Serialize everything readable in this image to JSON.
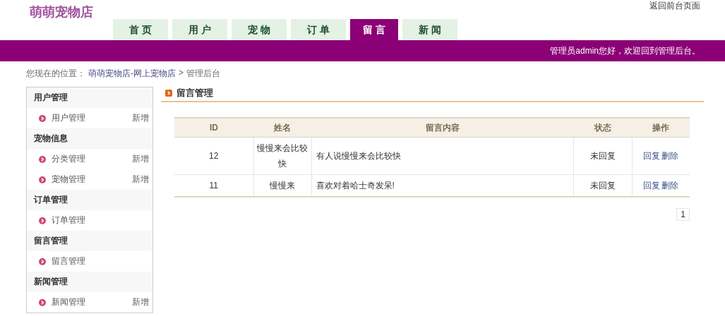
{
  "logo": "萌萌宠物店",
  "top_link": "返回前台页面",
  "nav_tabs": [
    {
      "label": "首 页",
      "selected": false
    },
    {
      "label": "用 户",
      "selected": false
    },
    {
      "label": "宠 物",
      "selected": false
    },
    {
      "label": "订 单",
      "selected": false
    },
    {
      "label": "留 言",
      "selected": true
    },
    {
      "label": "新 闻",
      "selected": false
    }
  ],
  "welcome": "管理员admin您好，欢迎回到管理后台。",
  "breadcrumb": {
    "prefix": "您现在的位置：",
    "link": "萌萌宠物店-网上宠物店",
    "separator": ">",
    "current": "管理后台"
  },
  "sidebar": [
    {
      "title": "用户管理",
      "items": [
        {
          "label": "用户管理",
          "action": "新增"
        }
      ]
    },
    {
      "title": "宠物信息",
      "items": [
        {
          "label": "分类管理",
          "action": "新增"
        },
        {
          "label": "宠物管理",
          "action": "新增"
        }
      ]
    },
    {
      "title": "订单管理",
      "items": [
        {
          "label": "订单管理"
        }
      ]
    },
    {
      "title": "留言管理",
      "items": [
        {
          "label": "留言管理"
        }
      ]
    },
    {
      "title": "新闻管理",
      "items": [
        {
          "label": "新闻管理",
          "action": "新增"
        }
      ]
    }
  ],
  "section_title": "留言管理",
  "table": {
    "columns": [
      "ID",
      "姓名",
      "留言内容",
      "状态",
      "操作"
    ],
    "rows": [
      {
        "cells": [
          "12",
          "慢慢来会比较快",
          "有人说慢慢来会比较快",
          "未回复"
        ],
        "actions": [
          "回复",
          "删除"
        ]
      },
      {
        "cells": [
          "11",
          "慢慢来",
          "喜欢对着哈士奇发呆!",
          "未回复"
        ],
        "actions": [
          "回复",
          "删除"
        ]
      }
    ]
  },
  "pagination": [
    "1"
  ]
}
